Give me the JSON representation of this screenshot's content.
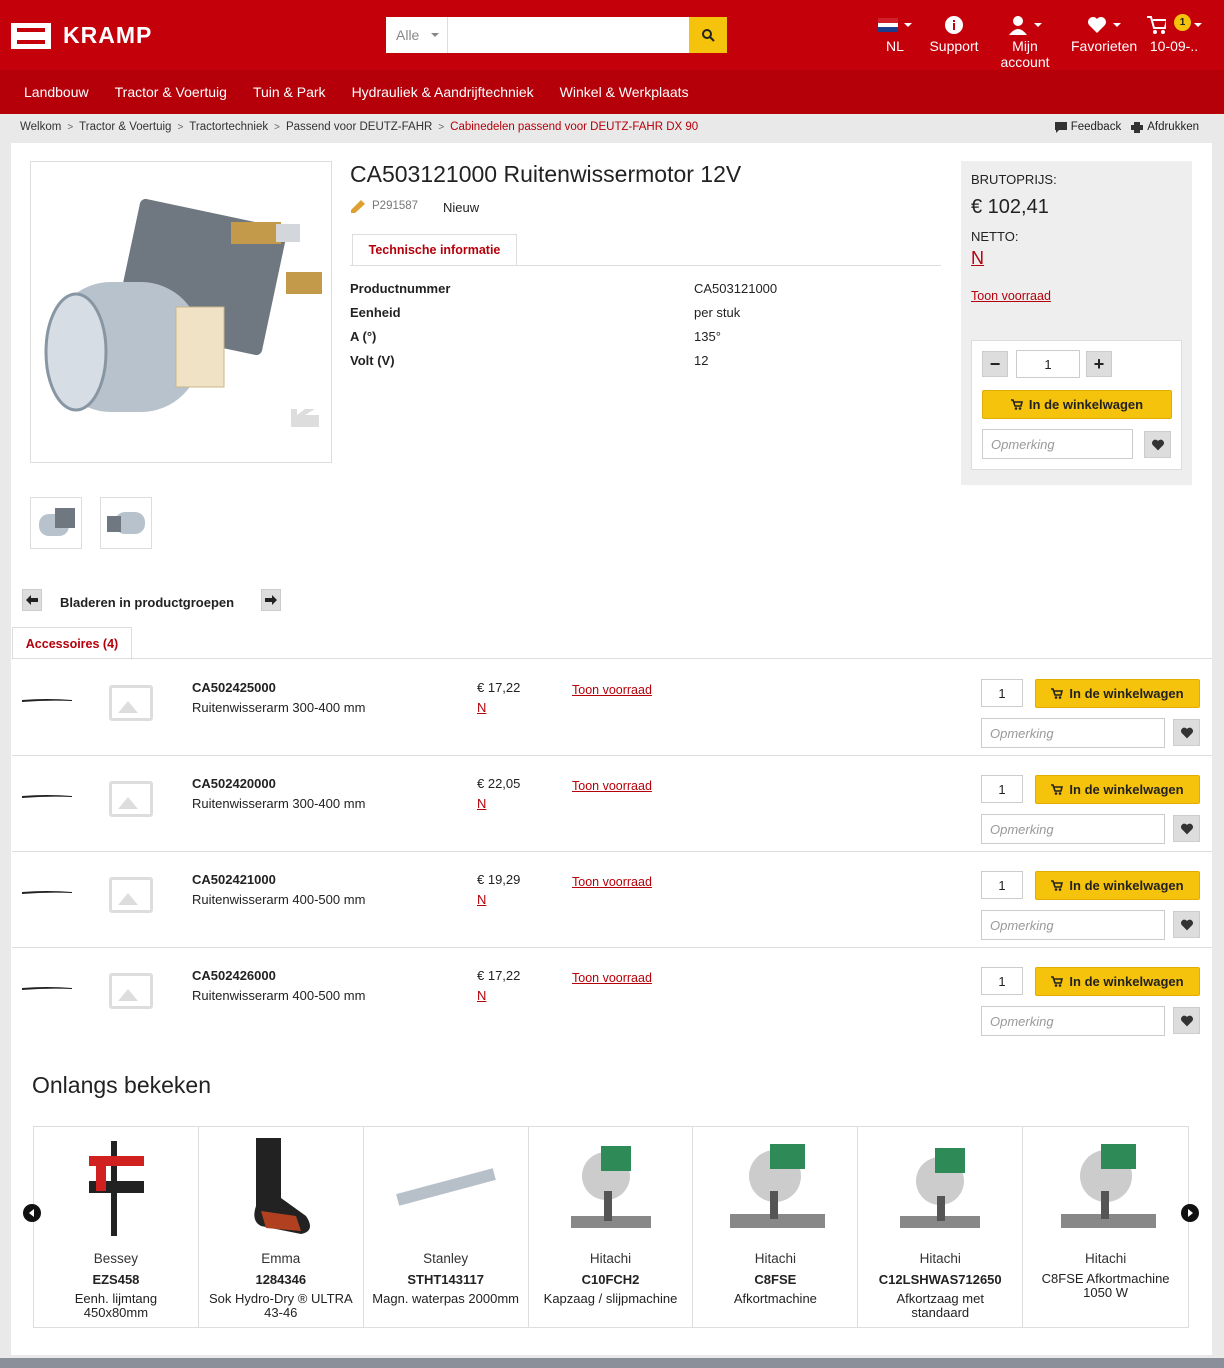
{
  "header": {
    "brand": "KRAMP",
    "search": {
      "category": "Alle",
      "placeholder": ""
    },
    "tools": {
      "language": "NL",
      "support": "Support",
      "account": "Mijn account",
      "favorites": "Favorieten",
      "cart_label": "10-09-..",
      "cart_count": "1"
    }
  },
  "nav": [
    "Landbouw",
    "Tractor & Voertuig",
    "Tuin & Park",
    "Hydrauliek & Aandrijftechniek",
    "Winkel & Werkplaats"
  ],
  "breadcrumb": [
    "Welkom",
    "Tractor & Voertuig",
    "Tractortechniek",
    "Passend voor DEUTZ-FAHR",
    "Cabinedelen passend voor DEUTZ-FAHR DX 90"
  ],
  "breadcrumb_tools": {
    "feedback": "Feedback",
    "print": "Afdrukken"
  },
  "product": {
    "title": "CA503121000 Ruitenwissermotor 12V",
    "code": "P291587",
    "badge": "Nieuw",
    "tab": "Technische informatie",
    "specs": [
      {
        "k": "Productnummer",
        "v": "CA503121000"
      },
      {
        "k": "Eenheid",
        "v": "per stuk"
      },
      {
        "k": "A (°)",
        "v": "135°"
      },
      {
        "k": "Volt (V)",
        "v": "12"
      }
    ]
  },
  "pricing": {
    "gross_label": "BRUTOPRIJS:",
    "gross_price": "€ 102,41",
    "net_label": "NETTO:",
    "net_value": "N",
    "stock_link": "Toon voorraad",
    "quantity": "1",
    "cart_button": "In de winkelwagen",
    "note_placeholder": "Opmerking"
  },
  "browse": {
    "label": "Bladeren in productgroepen"
  },
  "accessories": {
    "tab": "Accessoires (4)",
    "items": [
      {
        "code": "CA502425000",
        "name": "Ruitenwisserarm 300-400 mm",
        "price": "€ 17,22",
        "net": "N",
        "stock": "Toon voorraad",
        "qty": "1",
        "cart": "In de winkelwagen",
        "note": "Opmerking"
      },
      {
        "code": "CA502420000",
        "name": "Ruitenwisserarm 300-400 mm",
        "price": "€ 22,05",
        "net": "N",
        "stock": "Toon voorraad",
        "qty": "1",
        "cart": "In de winkelwagen",
        "note": "Opmerking"
      },
      {
        "code": "CA502421000",
        "name": "Ruitenwisserarm 400-500 mm",
        "price": "€ 19,29",
        "net": "N",
        "stock": "Toon voorraad",
        "qty": "1",
        "cart": "In de winkelwagen",
        "note": "Opmerking"
      },
      {
        "code": "CA502426000",
        "name": "Ruitenwisserarm 400-500 mm",
        "price": "€ 17,22",
        "net": "N",
        "stock": "Toon voorraad",
        "qty": "1",
        "cart": "In de winkelwagen",
        "note": "Opmerking"
      }
    ]
  },
  "recent": {
    "title": "Onlangs bekeken",
    "items": [
      {
        "brand": "Bessey",
        "code": "EZS458",
        "desc": "Eenh. lijmtang 450x80mm",
        "icon": "clamp-icon"
      },
      {
        "brand": "Emma",
        "code": "1284346",
        "desc": "Sok Hydro-Dry ® ULTRA 43-46",
        "icon": "sock-icon"
      },
      {
        "brand": "Stanley",
        "code": "STHT143117",
        "desc": "Magn. waterpas 2000mm",
        "icon": "level-icon"
      },
      {
        "brand": "Hitachi",
        "code": "C10FCH2",
        "desc": "Kapzaag / slijpmachine",
        "icon": "saw-icon"
      },
      {
        "brand": "Hitachi",
        "code": "C8FSE",
        "desc": "Afkortmachine",
        "icon": "saw-icon"
      },
      {
        "brand": "Hitachi",
        "code": "C12LSHWAS712650",
        "desc": "Afkortzaag met standaard",
        "icon": "saw-icon"
      },
      {
        "brand": "Hitachi",
        "code": "",
        "desc": "C8FSE Afkortmachine 1050 W",
        "icon": "saw-icon"
      }
    ]
  },
  "colors": {
    "brand_red": "#c4000b",
    "accent_yellow": "#f5c30c",
    "link_red": "#b5000a"
  }
}
